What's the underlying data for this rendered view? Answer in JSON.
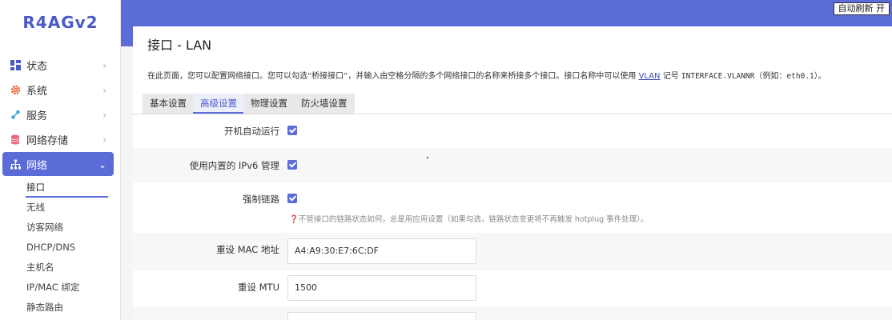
{
  "brand": {
    "logo": "R4AGv2"
  },
  "header": {
    "auto_refresh": "自动刷新 开"
  },
  "sidebar": {
    "items": [
      {
        "label": "状态",
        "icon": "dashboard-icon"
      },
      {
        "label": "系统",
        "icon": "gear-icon"
      },
      {
        "label": "服务",
        "icon": "share-icon"
      },
      {
        "label": "网络存储",
        "icon": "database-icon"
      },
      {
        "label": "网络",
        "icon": "sitemap-icon",
        "active": true
      }
    ],
    "submenu": [
      {
        "label": "接口",
        "current": true
      },
      {
        "label": "无线"
      },
      {
        "label": "访客网络"
      },
      {
        "label": "DHCP/DNS"
      },
      {
        "label": "主机名"
      },
      {
        "label": "IP/MAC 绑定"
      },
      {
        "label": "静态路由"
      }
    ]
  },
  "main": {
    "title": "接口 - LAN",
    "description_prefix": "在此页面，您可以配置网络接口。您可以勾选“桥接接口”，并输入由空格分隔的多个网络接口的名称来桥接多个接口。接口名称中可以使用",
    "description_link": "VLAN",
    "description_mid": "记号",
    "description_code": "INTERFACE.VLANNR",
    "description_example": "（例如：",
    "description_example_code": "eth0.1",
    "description_end": "）。",
    "tabs": [
      {
        "label": "基本设置"
      },
      {
        "label": "高级设置",
        "active": true
      },
      {
        "label": "物理设置"
      },
      {
        "label": "防火墙设置"
      }
    ],
    "fields": {
      "autostart": {
        "label": "开机自动运行",
        "checked": true
      },
      "ipv6": {
        "label": "使用内置的 IPv6 管理",
        "checked": true
      },
      "force_link": {
        "label": "强制链路",
        "checked": true,
        "hint": "不管接口的链路状态如何，总是用应用设置（如果勾选，链路状态变更将不再触发 hotplug 事件处理）。"
      },
      "mac": {
        "label": "重设 MAC 地址",
        "value": "A4:A9:30:E7:6C:DF"
      },
      "mtu": {
        "label": "重设 MTU",
        "value": "1500"
      }
    }
  },
  "colors": {
    "accent": "#5b6bd8",
    "brand": "#4a59c7"
  }
}
